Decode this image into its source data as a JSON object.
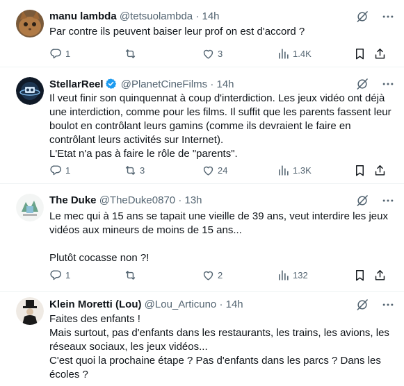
{
  "tweets": [
    {
      "name": "manu lambda",
      "handle": "@tetsuolambda",
      "time": "14h",
      "verified": false,
      "text": "Par contre ils peuvent baiser leur prof on est d'accord ?",
      "replies": "1",
      "retweets": "",
      "likes": "3",
      "views": "1.4K"
    },
    {
      "name": "StellarReel",
      "handle": "@PlanetCineFilms",
      "time": "14h",
      "verified": true,
      "text": "Il veut finir son quinquennat à coup d'interdiction. Les jeux vidéo ont déjà\nune interdiction, comme pour les films. Il suffit que les parents fassent leur\nboulot en contrôlant leurs gamins (comme ils devraient le faire en\ncontrôlant leurs activités sur Internet).\nL'Etat n'a pas à faire le rôle de \"parents\".",
      "replies": "1",
      "retweets": "3",
      "likes": "24",
      "views": "1.3K"
    },
    {
      "name": "The Duke",
      "handle": "@TheDuke0870",
      "time": "13h",
      "verified": false,
      "text": "Le mec qui à 15 ans se tapait une vieille de 39 ans, veut interdire les jeux\nvidéos aux mineurs de moins de 15 ans...\n\nPlutôt cocasse non ?!",
      "replies": "1",
      "retweets": "",
      "likes": "2",
      "views": "132"
    },
    {
      "name": "Klein Moretti (Lou)",
      "handle": "@Lou_Articuno",
      "time": "14h",
      "verified": false,
      "text": "Faites des enfants !\nMais surtout, pas d'enfants dans les restaurants, les trains, les avions, les\nréseaux sociaux, les jeux vidéos...\nC'est quoi la prochaine étape ? Pas d'enfants dans les parcs ? Dans les\nécoles ?",
      "replies": "",
      "retweets": "",
      "likes": "",
      "views": ""
    }
  ],
  "separator": "·",
  "colors": {
    "text": "#0f1419",
    "secondary": "#536471",
    "verified": "#1d9bf0",
    "divider": "#eff3f4"
  },
  "icons": [
    "grok-icon",
    "more-icon",
    "reply-icon",
    "retweet-icon",
    "like-icon",
    "views-icon",
    "bookmark-icon",
    "share-icon",
    "verified-badge-icon"
  ]
}
